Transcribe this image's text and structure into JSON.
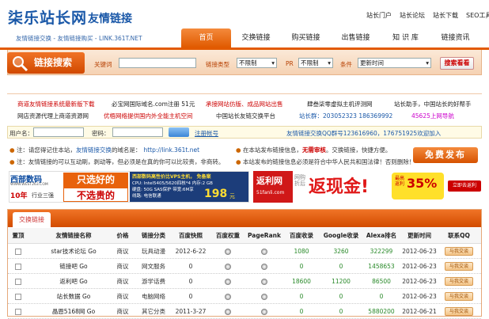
{
  "header": {
    "logo": "柒乐站长网",
    "logo_sub": "友情链接",
    "tagline": "友情链接交换 - 友情链接购买 - LINK.361T.NET",
    "top_links": [
      "站长门户",
      "站长论坛",
      "站长下载",
      "SEO工具"
    ]
  },
  "nav": {
    "tabs": [
      "首页",
      "交换链接",
      "购买链接",
      "出售链接",
      "知 识 库",
      "链接资讯"
    ],
    "active": 0
  },
  "search": {
    "badge": "链接搜索",
    "keyword_label": "关键词",
    "type_label": "链接类型",
    "type_value": "不限制",
    "pr_label": "PR",
    "pr_value": "不限制",
    "cond_label": "条件",
    "cond_value": "更新时间",
    "button": "搜索看看"
  },
  "ads": {
    "row1": [
      "商道友情链接系统最新版下载",
      "必宝网国际域名.com注册 51元",
      "承接网站仿版、成品网站出售",
      "肆叁柒零虚拟主机评测网",
      "站长助手，中国站长的好帮手"
    ],
    "row2": [
      "网店资源代理上商道资源网",
      "优梧网络提供国内外全能主机空间",
      "中国站长友链交换平台",
      "站长群：203052323  186369992",
      "45625上网导航"
    ]
  },
  "login": {
    "user_label": "用户名：",
    "pass_label": "密码：",
    "register": "注册帐号",
    "qq_group": "友情链接交换QQ群号123616960，176751925欢迎加入"
  },
  "notice": {
    "line1_prefix": "注：请您得记住本站，",
    "line1_link": "友情链接交换",
    "line1_domain_label": "的域名是：",
    "line1_domain": "http://link.361t.net",
    "line1_mid": "在本站发布链接信息，",
    "line1_free": "无需审核",
    "line1_tail": "。交换链接，快捷方便。",
    "line2": "注：友情链接的可以互动刷，剥动等，但必须是在真的你可以比较贵，非商转。",
    "line2_right": "本站发布的链接信息必须是符合中华人民共和国法律！否则删除！",
    "publish_button": "免费发布"
  },
  "banners": {
    "west_logo": "西部数码",
    "west_url": "WWW.WEST263.COM",
    "west_years": "10年",
    "west_rank": "行业三强",
    "west_slogan1": "只选好的",
    "west_slogan2": "不选贵的",
    "west_spec_title": "西部数码高性价比VPS主机， 免备案",
    "west_spec1": "CPU: Intel5405/5620四核*4   内存:2 GB",
    "west_spec2": "硬盘: 50G SAS保护   带宽:6M享   ",
    "west_spec3": "线路: 电信联通",
    "west_price": "198",
    "west_unit": "元",
    "fanli_logo": "返利网",
    "fanli_url": "51fanli.com",
    "fanli_tag": "网购折后",
    "fanli_main": "返现金!",
    "fanli_max": "最高返利",
    "fanli_pct": "35%",
    "fanli_btn": "立即去返利"
  },
  "table": {
    "tab": "交换链接",
    "columns": [
      "置顶",
      "友情链接名称",
      "价格",
      "链接分类",
      "百度快照",
      "百度权重",
      "PageRank",
      "百度收录",
      "Google收录",
      "Alexa排名",
      "更新时间",
      "联系QQ"
    ],
    "rows": [
      {
        "name": "star技术论坛 Go",
        "price": "商议",
        "cat": "玩具动漫",
        "snap": "2012-6-22",
        "bd": "1080",
        "gg": "3260",
        "alexa": "322299",
        "date": "2012-06-23"
      },
      {
        "name": "链接吧 Go",
        "price": "商议",
        "cat": "网文服务",
        "snap": "0",
        "bd": "0",
        "gg": "0",
        "alexa": "1458653",
        "date": "2012-06-23"
      },
      {
        "name": "返利吧 Go",
        "price": "商议",
        "cat": "游学话费",
        "snap": "0",
        "bd": "18600",
        "gg": "11200",
        "alexa": "86500",
        "date": "2012-06-23"
      },
      {
        "name": "站长数据 Go",
        "price": "商议",
        "cat": "电脑网络",
        "snap": "0",
        "bd": "0",
        "gg": "0",
        "alexa": "0",
        "date": "2012-06-23"
      },
      {
        "name": "晶恩5168网 Go",
        "price": "商议",
        "cat": "其它分类",
        "snap": "2011-3-27",
        "bd": "0",
        "gg": "0",
        "alexa": "5880200",
        "date": "2012-06-21"
      }
    ],
    "qq_label": "与我交谈"
  },
  "colors": {
    "orange": "#e25a00",
    "blue": "#1a58a8",
    "green": "#2a8a2a",
    "red": "#cc0000"
  }
}
